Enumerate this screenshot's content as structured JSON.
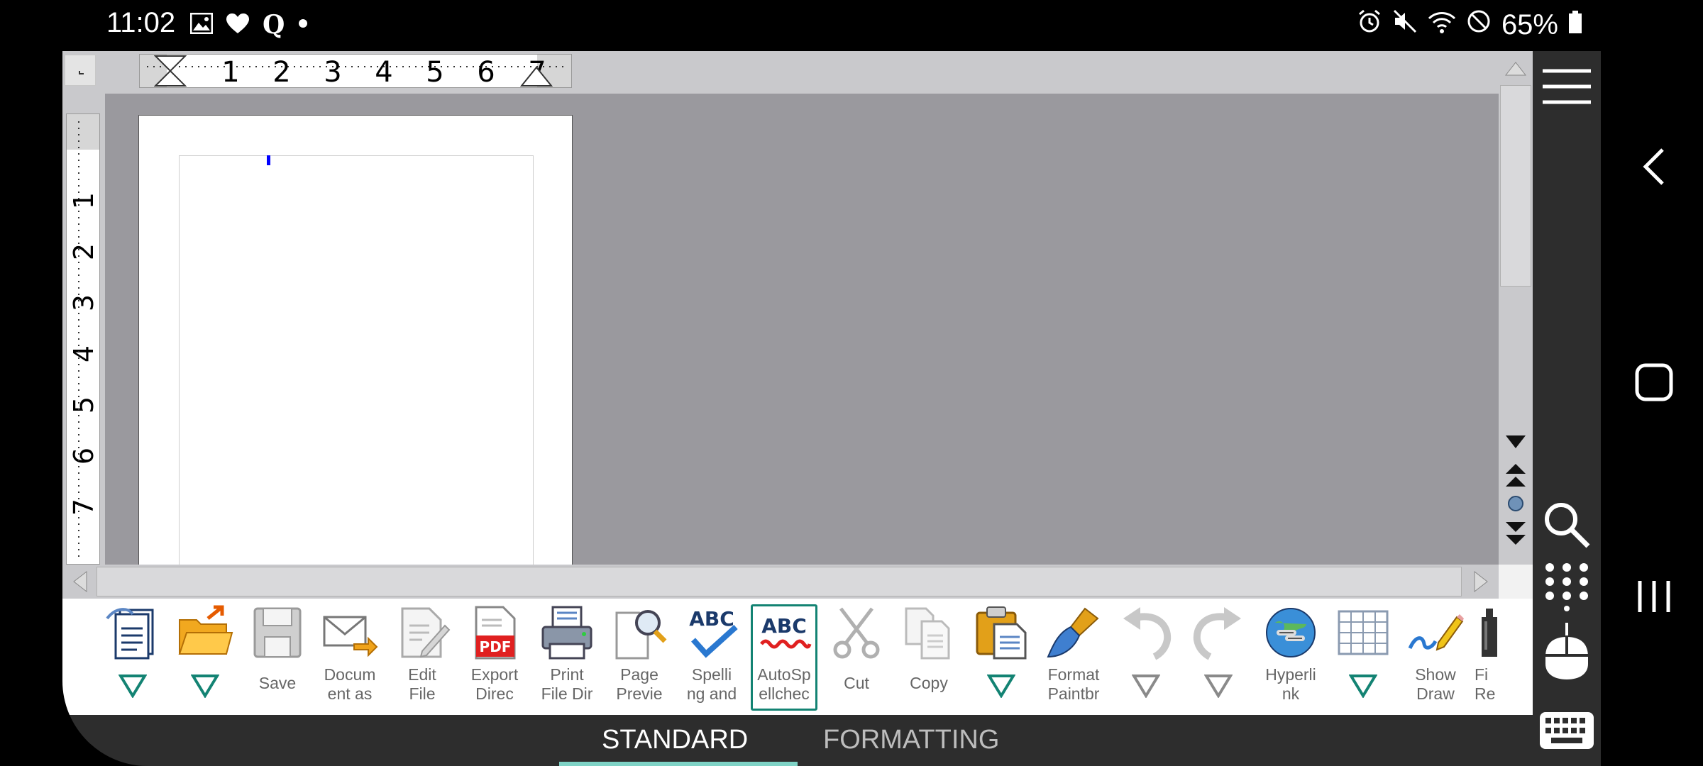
{
  "status_bar": {
    "time": "11:02",
    "left_icons": [
      "image-icon",
      "heart-icon",
      "q-app-icon",
      "dot-icon"
    ],
    "right_icons": [
      "alarm-icon",
      "mute-icon",
      "wifi-icon",
      "do-not-disturb-icon",
      "battery-icon"
    ],
    "battery": "65%"
  },
  "ruler": {
    "horizontal_numbers": [
      "1",
      "2",
      "3",
      "4",
      "5",
      "6",
      "7"
    ],
    "vertical_numbers": [
      "1",
      "2",
      "3",
      "4",
      "5",
      "6",
      "7"
    ]
  },
  "toolbar": {
    "tools": [
      {
        "name": "templates",
        "label": "",
        "dropdown": true,
        "icon": "templates-icon"
      },
      {
        "name": "open",
        "label": "",
        "dropdown": true,
        "icon": "open-folder-icon"
      },
      {
        "name": "save",
        "label": "Save",
        "icon": "save-icon"
      },
      {
        "name": "document-as-email",
        "label": "Docum\nent as",
        "icon": "email-icon"
      },
      {
        "name": "edit-file",
        "label": "Edit\nFile",
        "icon": "edit-file-icon"
      },
      {
        "name": "export-pdf",
        "label": "Export\nDirec",
        "icon": "pdf-icon"
      },
      {
        "name": "print",
        "label": "Print\nFile Dir",
        "icon": "printer-icon"
      },
      {
        "name": "page-preview",
        "label": "Page\nPrevie",
        "icon": "page-preview-icon"
      },
      {
        "name": "spelling",
        "label": "Spelli\nng and",
        "icon": "spelling-icon"
      },
      {
        "name": "autospellcheck",
        "label": "AutoSp\nellchec",
        "icon": "autospellcheck-icon",
        "active": true
      },
      {
        "name": "cut",
        "label": "Cut",
        "icon": "scissors-icon"
      },
      {
        "name": "copy",
        "label": "Copy",
        "icon": "copy-icon"
      },
      {
        "name": "paste",
        "label": "",
        "dropdown": true,
        "icon": "paste-icon"
      },
      {
        "name": "format-paintbrush",
        "label": "Format\nPaintbr",
        "icon": "paintbrush-icon"
      },
      {
        "name": "undo",
        "label": "",
        "dropdown": true,
        "icon": "undo-icon"
      },
      {
        "name": "redo",
        "label": "",
        "dropdown": true,
        "icon": "redo-icon"
      },
      {
        "name": "hyperlink",
        "label": "Hyperli\nnk",
        "icon": "hyperlink-icon"
      },
      {
        "name": "table",
        "label": "",
        "dropdown": true,
        "icon": "table-icon"
      },
      {
        "name": "show-draw",
        "label": "Show\nDraw",
        "icon": "draw-pencil-icon"
      },
      {
        "name": "find-replace",
        "label": "Fi\nRe",
        "icon": "find-replace-icon"
      }
    ]
  },
  "tabs": {
    "standard": "STANDARD",
    "formatting": "FORMATTING",
    "selected": "STANDARD"
  },
  "side_panel": {
    "icons": [
      "menu-icon",
      "search-icon",
      "dialpad-icon",
      "mouse-icon",
      "keyboard-icon"
    ]
  },
  "nav_bar": {
    "icons": [
      "back-icon",
      "home-icon",
      "recents-icon"
    ]
  },
  "colors": {
    "accent": "#138373",
    "tab_indicator": "#7fd3c6",
    "canvas_bg": "#9a999e",
    "app_bg": "#2d2d2d"
  }
}
